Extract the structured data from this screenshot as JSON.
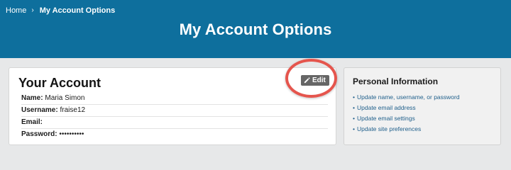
{
  "breadcrumb": {
    "home": "Home",
    "separator": "›",
    "current": "My Account Options"
  },
  "page": {
    "title": "My Account Options"
  },
  "account": {
    "heading": "Your Account",
    "edit_label": "Edit",
    "fields": {
      "name": {
        "label": "Name:",
        "value": "Maria Simon"
      },
      "username": {
        "label": "Username:",
        "value": "fraise12"
      },
      "email": {
        "label": "Email:",
        "value": ""
      },
      "password": {
        "label": "Password:",
        "value": "••••••••••"
      }
    }
  },
  "personal_info": {
    "heading": "Personal Information",
    "links": [
      "Update name, username, or password",
      "Update email address",
      "Update email settings",
      "Update site preferences"
    ]
  },
  "colors": {
    "header_blue": "#0e6f9d",
    "link_blue": "#1f5f8b",
    "edit_button_gray": "#666666",
    "highlight_red": "#e5554d"
  },
  "icons": {
    "edit": "pencil-icon",
    "breadcrumb_separator": "chevron-right-icon"
  }
}
